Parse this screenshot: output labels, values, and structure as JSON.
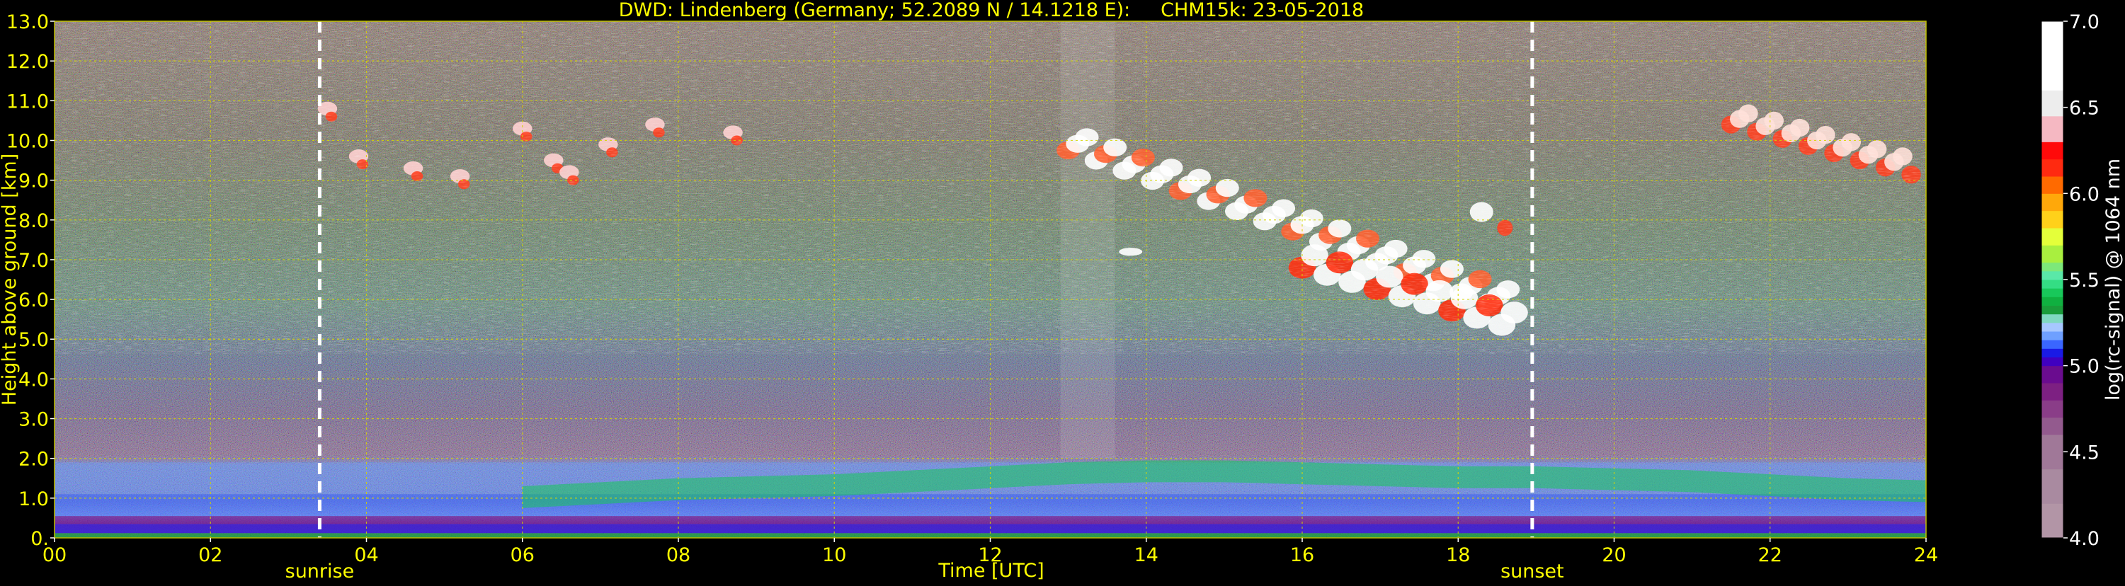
{
  "chart_data": {
    "type": "heatmap",
    "title": "DWD: Lindenberg (Germany; 52.2089 N / 14.1218 E):     CHM15k: 23-05-2018",
    "xlabel": "Time [UTC]",
    "ylabel": "Height above ground [km]",
    "xlim": [
      0,
      24
    ],
    "ylim": [
      0,
      13
    ],
    "x_ticks": [
      "00",
      "02",
      "04",
      "06",
      "08",
      "10",
      "12",
      "14",
      "16",
      "18",
      "20",
      "22",
      "24"
    ],
    "y_ticks": [
      "0.",
      "1.0",
      "2.0",
      "3.0",
      "4.0",
      "5.0",
      "6.0",
      "7.0",
      "8.0",
      "9.0",
      "10.0",
      "11.0",
      "12.0",
      "13.0"
    ],
    "grid": true,
    "markers": [
      {
        "label": "sunrise",
        "x": 3.4
      },
      {
        "label": "sunset",
        "x": 18.95
      }
    ],
    "colorbar": {
      "label": "log(rc-signal) @ 1064 nm",
      "range": [
        4.0,
        7.0
      ],
      "ticks": [
        "4.0",
        "4.5",
        "5.0",
        "5.5",
        "6.0",
        "6.5",
        "7.0"
      ],
      "levels": [
        {
          "v": 4.0,
          "color": "#b295a6"
        },
        {
          "v": 4.2,
          "color": "#a98aa0"
        },
        {
          "v": 4.4,
          "color": "#a07898"
        },
        {
          "v": 4.6,
          "color": "#935a8e"
        },
        {
          "v": 4.7,
          "color": "#8a3d88"
        },
        {
          "v": 4.8,
          "color": "#7d2082"
        },
        {
          "v": 4.9,
          "color": "#6a0c8f"
        },
        {
          "v": 5.0,
          "color": "#4000c0"
        },
        {
          "v": 5.05,
          "color": "#1a1ae6"
        },
        {
          "v": 5.1,
          "color": "#3a66ff"
        },
        {
          "v": 5.15,
          "color": "#6fa0ff"
        },
        {
          "v": 5.2,
          "color": "#a7c7ff"
        },
        {
          "v": 5.25,
          "color": "#80d8c0"
        },
        {
          "v": 5.3,
          "color": "#1a9c3a"
        },
        {
          "v": 5.35,
          "color": "#10b040"
        },
        {
          "v": 5.4,
          "color": "#18c85a"
        },
        {
          "v": 5.45,
          "color": "#34dd84"
        },
        {
          "v": 5.5,
          "color": "#5ae8a8"
        },
        {
          "v": 5.55,
          "color": "#7de87a"
        },
        {
          "v": 5.6,
          "color": "#a9ef3f"
        },
        {
          "v": 5.7,
          "color": "#e4ff3a"
        },
        {
          "v": 5.8,
          "color": "#ffd11a"
        },
        {
          "v": 5.9,
          "color": "#ffa80a"
        },
        {
          "v": 6.0,
          "color": "#ff6a00"
        },
        {
          "v": 6.1,
          "color": "#ff2a10"
        },
        {
          "v": 6.2,
          "color": "#ff0a0a"
        },
        {
          "v": 6.3,
          "color": "#f5b8c2"
        },
        {
          "v": 6.45,
          "color": "#ededed"
        },
        {
          "v": 6.6,
          "color": "#ffffff"
        },
        {
          "v": 7.0,
          "color": "#ffffff"
        }
      ]
    },
    "regions": [
      {
        "name": "boundary-layer",
        "x": [
          0,
          24
        ],
        "y": [
          0,
          2.0
        ],
        "dominant": "blue"
      },
      {
        "name": "aerosol-layer-green",
        "x": [
          6,
          24
        ],
        "y": [
          1.0,
          2.0
        ],
        "dominant": "green"
      },
      {
        "name": "cirrus-morning",
        "x": [
          3.4,
          9.2
        ],
        "y": [
          9.0,
          11.0
        ],
        "dominant": "white/red"
      },
      {
        "name": "cirrus-afternoon",
        "x": [
          13.0,
          18.9
        ],
        "y": [
          5.0,
          10.5
        ],
        "dominant": "white/red"
      },
      {
        "name": "cirrus-evening",
        "x": [
          21.5,
          24
        ],
        "y": [
          8.5,
          11.0
        ],
        "dominant": "white/red"
      }
    ]
  },
  "colors": {
    "background": "#000000",
    "text": "#ffff00",
    "grid": "#d6d600",
    "marker_line": "#ffffff",
    "colorbar_label": "#ffffff"
  }
}
